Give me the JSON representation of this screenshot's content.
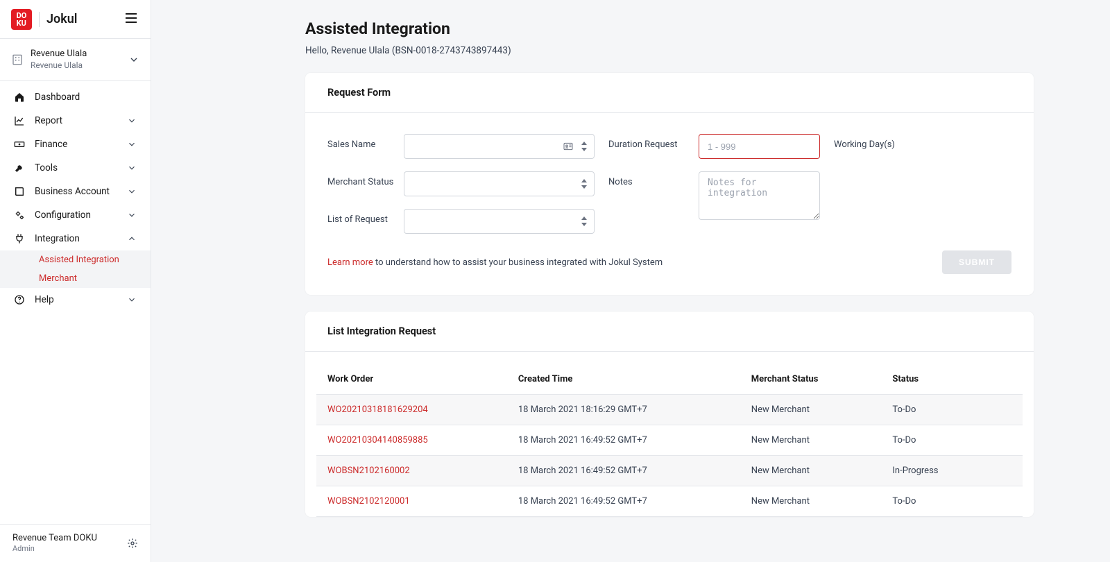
{
  "brand": {
    "logo_text": "DO\nKU",
    "name": "Jokul"
  },
  "account": {
    "name": "Revenue Ulala",
    "sub": "Revenue Ulala"
  },
  "sidebar": {
    "items": [
      {
        "label": "Dashboard",
        "icon": "home-icon",
        "expandable": false
      },
      {
        "label": "Report",
        "icon": "chart-icon",
        "expandable": true
      },
      {
        "label": "Finance",
        "icon": "money-icon",
        "expandable": true
      },
      {
        "label": "Tools",
        "icon": "wrench-icon",
        "expandable": true
      },
      {
        "label": "Business Account",
        "icon": "book-icon",
        "expandable": true
      },
      {
        "label": "Configuration",
        "icon": "gears-icon",
        "expandable": true
      },
      {
        "label": "Integration",
        "icon": "plug-icon",
        "expandable": true,
        "expanded": true,
        "children": [
          {
            "label": "Assisted Integration"
          },
          {
            "label": "Merchant"
          }
        ]
      },
      {
        "label": "Help",
        "icon": "help-icon",
        "expandable": true
      }
    ]
  },
  "footer": {
    "name": "Revenue Team DOKU",
    "role": "Admin"
  },
  "page": {
    "title": "Assisted Integration",
    "greeting": "Hello, Revenue Ulala (BSN-0018-2743743897443)"
  },
  "form": {
    "header": "Request Form",
    "labels": {
      "sales_name": "Sales Name",
      "merchant_status": "Merchant Status",
      "list_of_request": "List of Request",
      "duration_request": "Duration Request",
      "notes": "Notes",
      "working_days": "Working Day(s)"
    },
    "placeholders": {
      "duration": "1 - 999",
      "notes": "Notes for integration"
    },
    "learn_more_link": "Learn more",
    "learn_more_text": " to understand how to assist your business integrated with Jokul System",
    "submit": "SUBMIT"
  },
  "list": {
    "header": "List Integration Request",
    "columns": [
      "Work Order",
      "Created Time",
      "Merchant Status",
      "Status"
    ],
    "rows": [
      {
        "wo": "WO20210318181629204",
        "created": "18 March 2021 18:16:29 GMT+7",
        "merchant": "New Merchant",
        "status": "To-Do"
      },
      {
        "wo": "WO20210304140859885",
        "created": "18 March 2021 16:49:52 GMT+7",
        "merchant": "New Merchant",
        "status": "To-Do"
      },
      {
        "wo": "WOBSN2102160002",
        "created": "18 March 2021 16:49:52 GMT+7",
        "merchant": "New Merchant",
        "status": "In-Progress"
      },
      {
        "wo": "WOBSN2102120001",
        "created": "18 March 2021 16:49:52 GMT+7",
        "merchant": "New Merchant",
        "status": "To-Do"
      }
    ]
  }
}
